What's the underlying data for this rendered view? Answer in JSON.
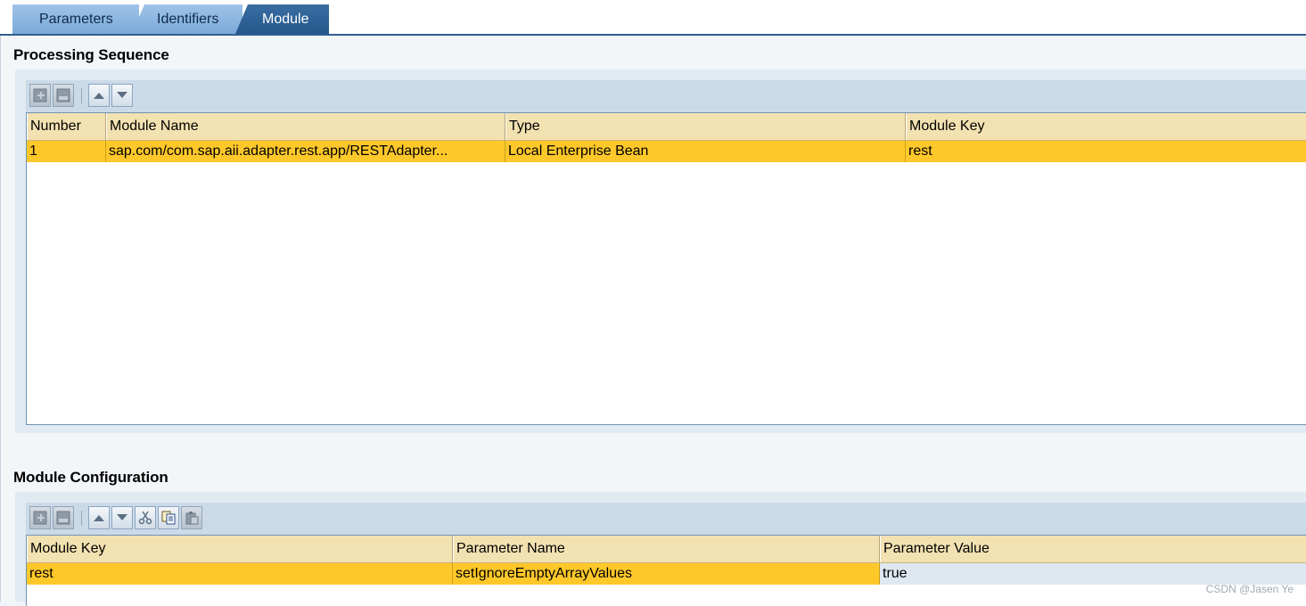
{
  "tabs": [
    {
      "label": "Parameters"
    },
    {
      "label": "Identifiers"
    },
    {
      "label": "Module"
    }
  ],
  "processing_sequence": {
    "title": "Processing Sequence",
    "columns": [
      "Number",
      "Module Name",
      "Type",
      "Module Key"
    ],
    "rows": [
      [
        "1",
        "sap.com/com.sap.aii.adapter.rest.app/RESTAdapter...",
        "Local Enterprise Bean",
        "rest"
      ]
    ]
  },
  "module_configuration": {
    "title": "Module Configuration",
    "columns": [
      "Module Key",
      "Parameter Name",
      "Parameter Value"
    ],
    "rows": [
      [
        "rest",
        "setIgnoreEmptyArrayValues",
        "true"
      ]
    ]
  },
  "watermark": "CSDN @Jasen Ye",
  "colors": {
    "active_tab": "#2a5c8f",
    "selected_row": "#ffc82a",
    "header": "#f2e1b1"
  }
}
